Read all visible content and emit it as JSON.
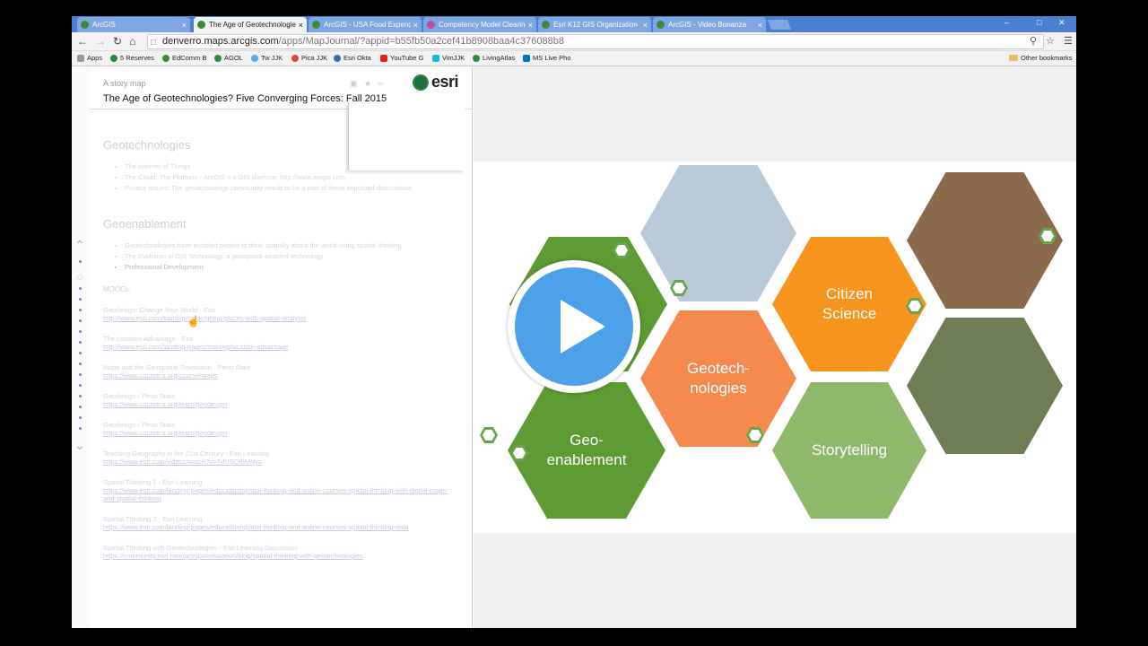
{
  "browser": {
    "tabs": [
      {
        "title": "ArcGIS",
        "active": false
      },
      {
        "title": "The Age of Geotechnologies",
        "active": true
      },
      {
        "title": "ArcGIS - USA Food Expendi",
        "active": false
      },
      {
        "title": "Competency Model Clearing",
        "active": false
      },
      {
        "title": "Esri K12 GIS Organization",
        "active": false
      },
      {
        "title": "ArcGIS - Video Bonanza",
        "active": false
      }
    ],
    "tab_close": "×",
    "window_controls": {
      "minimize": "–",
      "maximize": "□",
      "close": "✕"
    },
    "url_host": "denverro.maps.arcgis.com",
    "url_path": "/apps/MapJournal/?appid=b55fb50a2cef41b8908baa4c376088b8",
    "bookmarks": [
      {
        "label": "Apps",
        "color": "#999999"
      },
      {
        "label": "5 Reserves",
        "color": "#2a8a3a"
      },
      {
        "label": "EdComm B",
        "color": "#3a8a3a"
      },
      {
        "label": "AGOL",
        "color": "#3a8a3a"
      },
      {
        "label": "Tw JJK",
        "color": "#55acee"
      },
      {
        "label": "Pica JJK",
        "color": "#dd4b39"
      },
      {
        "label": "Esri Okta",
        "color": "#3a6ea8"
      },
      {
        "label": "YouTube G",
        "color": "#e62117"
      },
      {
        "label": "VimJJK",
        "color": "#1ab7ea"
      },
      {
        "label": "LivingAtlas",
        "color": "#3a8a3a"
      },
      {
        "label": "MS Live Pho",
        "color": "#0072c6"
      }
    ],
    "other_bookmarks": "Other bookmarks"
  },
  "story": {
    "subtitle": "A story map",
    "title": "The Age of Geotechnologies? Five Converging Forces: Fall 2015",
    "logo": "esri"
  },
  "left_panel": {
    "sections": [
      {
        "heading": "Geotechnologies",
        "bullets": [
          "The Internet of Things",
          "The Cloud: The Platform - ArcGIS = a GIS platform: http://www.arcgis.com",
          "Privacy issues: The geotechnology community needs to be a part of these important discussions."
        ]
      },
      {
        "heading": "Geoenablement",
        "bullets": [
          "Geotechnologies have enabled people to think spatially about the world using spatial thinking",
          "The Evolution of GIS Technology: a geospatial-enabled technology",
          "Professional Development"
        ]
      }
    ],
    "moocs_heading": "MOOCs:",
    "links": [
      {
        "title": "Geodesign: Change Your World - Esri",
        "url": "http://www.esri.com/training/mooc/going-places-with-spatial-analysis"
      },
      {
        "title": "The Location Advantage - Esri",
        "url": "http://www.esri.com/landing-pages/training/location-advantage"
      },
      {
        "title": "Maps and the Geospatial Revolution - Penn State",
        "url": "https://www.coursera.org/course/maps"
      },
      {
        "title": "Geodesign - Penn State",
        "url": "https://www.coursera.org/learn/geodesign"
      },
      {
        "title": "Geodesign - Penn State",
        "url": "https://www.coursera.org/learn/geodesign"
      },
      {
        "title": "Teaching Geography in the 21st Century - Esri Learning",
        "url": "https://www.esri.com/videos/watch?v=TdUSQt9MNyo"
      },
      {
        "title": "Spatial Thinking 1 - Esri Learning",
        "url": "https://www.esri.com/landing-pages/education/spatial-thinking-and-online-courses-spatial-thinking-with-digital-maps-and-spatial-thinking"
      },
      {
        "title": "Spatial Thinking 2 - Esri Learning",
        "url": "https://www.esri.com/landing-pages/education/spatial-thinking-and-online-courses-spatial-thinking-data"
      },
      {
        "title": "Spatial Thinking with Geotechnologies - Esri Learning Discussion",
        "url": "https://community.esri.com/groups/education/blog/spatial-thinking-with-geotechnologies"
      }
    ]
  },
  "slide": {
    "hexes": [
      {
        "label": "Citizen Science",
        "color": "#f7941d"
      },
      {
        "label": "Geotech-nologies",
        "color": "#f58a4f"
      },
      {
        "label": "Geo-enablement",
        "color": "#5d9b34"
      },
      {
        "label": "Storytelling",
        "color": "#8fb96a"
      }
    ],
    "play_button_color": "#4ca1e8"
  }
}
